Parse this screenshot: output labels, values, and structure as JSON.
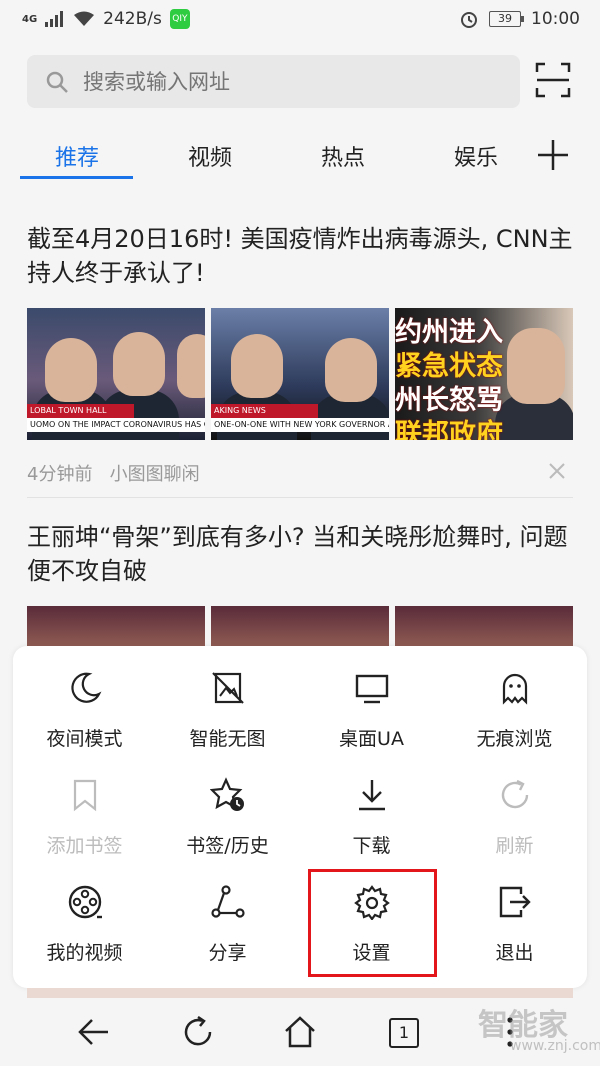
{
  "status_bar": {
    "network": "4G",
    "speed": "242B/s",
    "app_badge": "QIY",
    "battery": "39",
    "time": "10:00"
  },
  "search": {
    "placeholder": "搜索或输入网址"
  },
  "tabs": [
    {
      "label": "推荐",
      "active": true
    },
    {
      "label": "视频",
      "active": false
    },
    {
      "label": "热点",
      "active": false
    },
    {
      "label": "娱乐",
      "active": false
    }
  ],
  "articles": [
    {
      "title": "截至4月20日16时! 美国疫情炸出病毒源头, CNN主持人终于承认了!",
      "time": "4分钟前",
      "source": "小图图聊闲",
      "thumb1_ticker_red": "LOBAL TOWN HALL",
      "thumb1_ticker": "UOMO ON THE IMPACT CORONAVIRUS HAS ON HIS FAMILY",
      "thumb2_ticker_red": "AKING NEWS",
      "thumb2_ticker": "ONE-ON-ONE WITH NEW YORK GOVERNOR ANDREW CUOMO",
      "thumb3_overlay_l1": "约州进入",
      "thumb3_overlay_l2": "紧急状态",
      "thumb3_overlay_l3": "州长怒骂",
      "thumb3_overlay_l4": "联邦政府"
    },
    {
      "title": "王丽坤“骨架”到底有多小? 当和关晓彤尬舞时, 问题便不攻自破"
    }
  ],
  "menu": {
    "items": [
      {
        "label": "夜间模式",
        "icon": "moon-icon",
        "enabled": true
      },
      {
        "label": "智能无图",
        "icon": "no-image-icon",
        "enabled": true
      },
      {
        "label": "桌面UA",
        "icon": "desktop-icon",
        "enabled": true
      },
      {
        "label": "无痕浏览",
        "icon": "ghost-icon",
        "enabled": true
      },
      {
        "label": "添加书签",
        "icon": "bookmark-icon",
        "enabled": false
      },
      {
        "label": "书签/历史",
        "icon": "star-history-icon",
        "enabled": true
      },
      {
        "label": "下载",
        "icon": "download-icon",
        "enabled": true
      },
      {
        "label": "刷新",
        "icon": "refresh-icon",
        "enabled": false
      },
      {
        "label": "我的视频",
        "icon": "film-reel-icon",
        "enabled": true
      },
      {
        "label": "分享",
        "icon": "share-icon",
        "enabled": true
      },
      {
        "label": "设置",
        "icon": "gear-icon",
        "enabled": true,
        "highlighted": true
      },
      {
        "label": "退出",
        "icon": "exit-icon",
        "enabled": true
      }
    ]
  },
  "bottom_nav": {
    "tab_count": "1"
  },
  "watermark": {
    "text": "智能家",
    "url": "www.znj.com"
  },
  "colors": {
    "accent": "#1a73e8",
    "highlight": "#e3161b"
  }
}
